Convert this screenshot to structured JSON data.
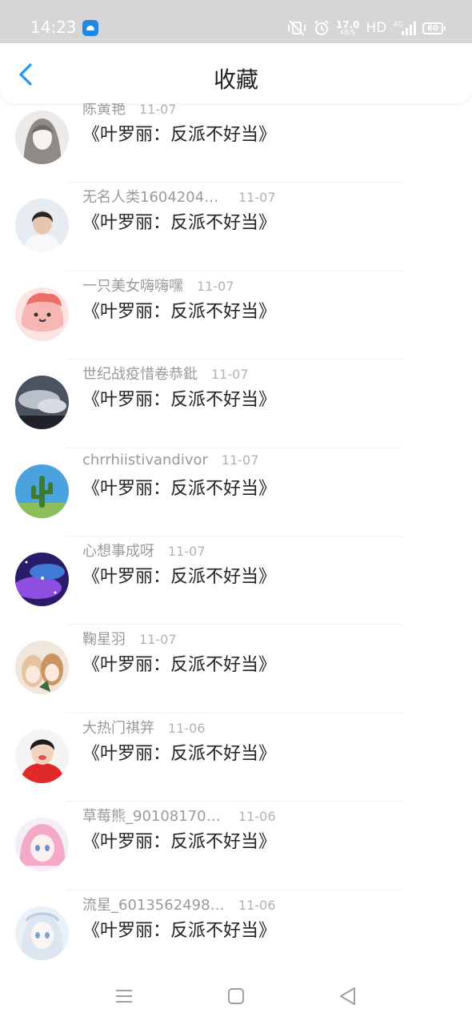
{
  "status_bar": {
    "time": "14:23",
    "app_icon": "android-app-icon",
    "icons": [
      "vibrate-off-icon",
      "alarm-icon"
    ],
    "net_speed_value": "17.0",
    "net_speed_unit": "KB/S",
    "hd": "HD",
    "network": "4G",
    "battery": "60",
    "text_color": "#ffffff",
    "background": "#d6d6d6"
  },
  "header": {
    "back_icon": "chevron-left-icon",
    "title": "收藏",
    "accent": "#2196f3"
  },
  "favorites": [
    {
      "user": "陈黄艳",
      "date": "11-07",
      "title": "《叶罗丽：反派不好当》",
      "avatar": "anime-girl-sketch"
    },
    {
      "user": "无名人类1604204…",
      "date": "11-07",
      "title": "《叶罗丽：反派不好当》",
      "avatar": "girl-photo"
    },
    {
      "user": "一只美女嗨嗨嘿",
      "date": "11-07",
      "title": "《叶罗丽：反派不好当》",
      "avatar": "pink-cartoon"
    },
    {
      "user": "世纪战疫惜卷恭鈚",
      "date": "11-07",
      "title": "《叶罗丽：反派不好当》",
      "avatar": "cloudy-sky"
    },
    {
      "user": "chrrhiistivandivor",
      "date": "11-07",
      "title": "《叶罗丽：反派不好当》",
      "avatar": "cactus-sky"
    },
    {
      "user": "心想事成呀",
      "date": "11-07",
      "title": "《叶罗丽：反派不好当》",
      "avatar": "galaxy"
    },
    {
      "user": "鞠星羽",
      "date": "11-07",
      "title": "《叶罗丽：反派不好当》",
      "avatar": "anime-girls"
    },
    {
      "user": "大热门祺笄",
      "date": "11-06",
      "title": "《叶罗丽：反派不好当》",
      "avatar": "child-red"
    },
    {
      "user": "草莓熊_90108170…",
      "date": "11-06",
      "title": "《叶罗丽：反派不好当》",
      "avatar": "pink-anime"
    },
    {
      "user": "流星_6013562498…",
      "date": "11-06",
      "title": "《叶罗丽：反派不好当》",
      "avatar": "white-hair-anime"
    }
  ],
  "nav_bar": {
    "buttons": [
      "menu-icon",
      "home-square-icon",
      "back-triangle-icon"
    ],
    "icon_color": "#a0a0a0"
  }
}
